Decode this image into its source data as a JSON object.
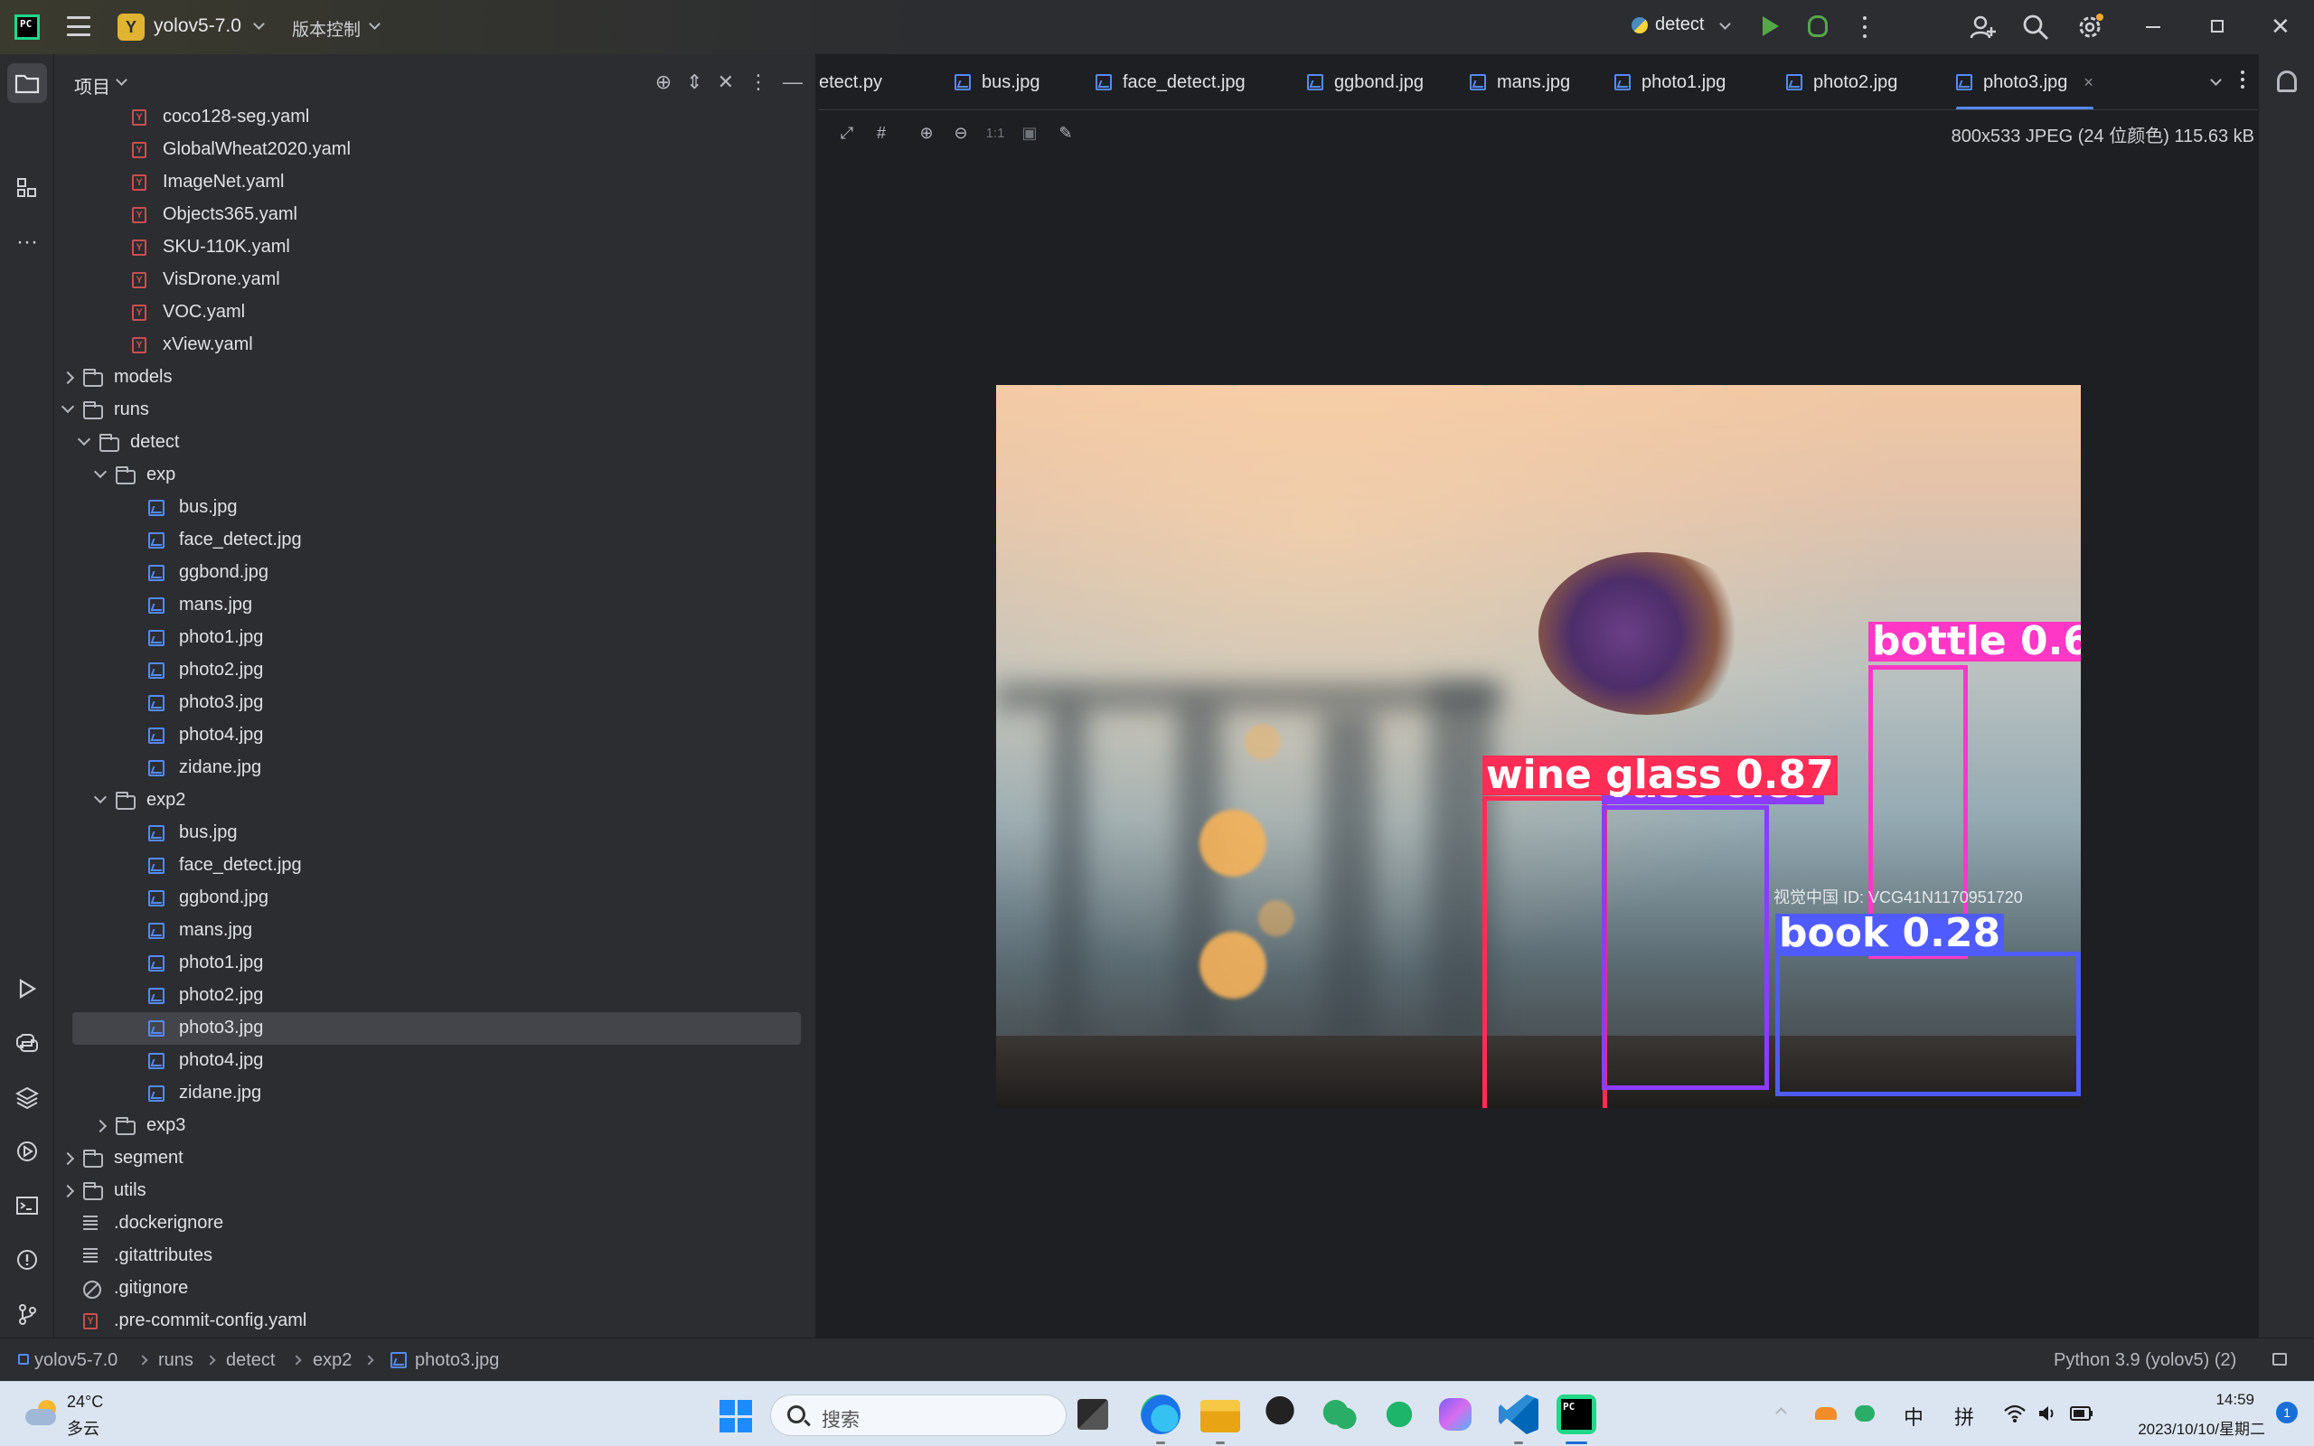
{
  "titlebar": {
    "project_badge": "Y",
    "project_name": "yolov5-7.0",
    "vcs_label": "版本控制",
    "run_config": "detect"
  },
  "project_panel": {
    "title": "项目",
    "tree": [
      {
        "label": "coco128-seg.yaml",
        "type": "yaml",
        "depth": 4
      },
      {
        "label": "GlobalWheat2020.yaml",
        "type": "yaml",
        "depth": 4
      },
      {
        "label": "ImageNet.yaml",
        "type": "yaml",
        "depth": 4
      },
      {
        "label": "Objects365.yaml",
        "type": "yaml",
        "depth": 4
      },
      {
        "label": "SKU-110K.yaml",
        "type": "yaml",
        "depth": 4
      },
      {
        "label": "VisDrone.yaml",
        "type": "yaml",
        "depth": 4
      },
      {
        "label": "VOC.yaml",
        "type": "yaml",
        "depth": 4
      },
      {
        "label": "xView.yaml",
        "type": "yaml",
        "depth": 4
      },
      {
        "label": "models",
        "type": "folder",
        "depth": 1,
        "arrow": "right"
      },
      {
        "label": "runs",
        "type": "folder",
        "depth": 1,
        "arrow": "down"
      },
      {
        "label": "detect",
        "type": "folder",
        "depth": 2,
        "arrow": "down"
      },
      {
        "label": "exp",
        "type": "folder",
        "depth": 3,
        "arrow": "down"
      },
      {
        "label": "bus.jpg",
        "type": "image",
        "depth": 5
      },
      {
        "label": "face_detect.jpg",
        "type": "image",
        "depth": 5
      },
      {
        "label": "ggbond.jpg",
        "type": "image",
        "depth": 5
      },
      {
        "label": "mans.jpg",
        "type": "image",
        "depth": 5
      },
      {
        "label": "photo1.jpg",
        "type": "image",
        "depth": 5
      },
      {
        "label": "photo2.jpg",
        "type": "image",
        "depth": 5
      },
      {
        "label": "photo3.jpg",
        "type": "image",
        "depth": 5
      },
      {
        "label": "photo4.jpg",
        "type": "image",
        "depth": 5
      },
      {
        "label": "zidane.jpg",
        "type": "image",
        "depth": 5
      },
      {
        "label": "exp2",
        "type": "folder",
        "depth": 3,
        "arrow": "down"
      },
      {
        "label": "bus.jpg",
        "type": "image",
        "depth": 5
      },
      {
        "label": "face_detect.jpg",
        "type": "image",
        "depth": 5
      },
      {
        "label": "ggbond.jpg",
        "type": "image",
        "depth": 5
      },
      {
        "label": "mans.jpg",
        "type": "image",
        "depth": 5
      },
      {
        "label": "photo1.jpg",
        "type": "image",
        "depth": 5
      },
      {
        "label": "photo2.jpg",
        "type": "image",
        "depth": 5
      },
      {
        "label": "photo3.jpg",
        "type": "image",
        "depth": 5,
        "selected": true
      },
      {
        "label": "photo4.jpg",
        "type": "image",
        "depth": 5
      },
      {
        "label": "zidane.jpg",
        "type": "image",
        "depth": 5
      },
      {
        "label": "exp3",
        "type": "folder",
        "depth": 3,
        "arrow": "right"
      },
      {
        "label": "segment",
        "type": "folder",
        "depth": 1,
        "arrow": "right"
      },
      {
        "label": "utils",
        "type": "folder",
        "depth": 1,
        "arrow": "right"
      },
      {
        "label": ".dockerignore",
        "type": "text",
        "depth": 1
      },
      {
        "label": ".gitattributes",
        "type": "text",
        "depth": 1
      },
      {
        "label": ".gitignore",
        "type": "ignore",
        "depth": 1
      },
      {
        "label": ".pre-commit-config.yaml",
        "type": "yaml",
        "depth": 1
      }
    ]
  },
  "editor": {
    "tabs": [
      {
        "label": "etect.py",
        "icon": "none"
      },
      {
        "label": "bus.jpg",
        "icon": "image"
      },
      {
        "label": "face_detect.jpg",
        "icon": "image"
      },
      {
        "label": "ggbond.jpg",
        "icon": "image"
      },
      {
        "label": "mans.jpg",
        "icon": "image"
      },
      {
        "label": "photo1.jpg",
        "icon": "image"
      },
      {
        "label": "photo2.jpg",
        "icon": "image"
      },
      {
        "label": "photo3.jpg",
        "icon": "image",
        "active": true
      }
    ],
    "tab_close": "×",
    "image_toolbar": {
      "actual_size_label": "1:1"
    },
    "image_info": "800x533 JPEG (24 位颜色) 115.63 kB",
    "detections": [
      {
        "label": "wine glass 0.87",
        "color": "#ff2d55"
      },
      {
        "label": "vase 0.85",
        "color": "#8b3dff"
      },
      {
        "label": "bottle 0.6",
        "color": "#ff37c7"
      },
      {
        "label": "book 0.28",
        "color": "#4f5bff"
      }
    ],
    "watermark": "视觉中国  ID: VCG41N1170951720"
  },
  "statusbar": {
    "breadcrumbs": [
      "yolov5-7.0",
      "runs",
      "detect",
      "exp2",
      "photo3.jpg"
    ],
    "interpreter": "Python 3.9 (yolov5) (2)"
  },
  "taskbar": {
    "temperature": "24°C",
    "condition": "多云",
    "search_placeholder": "搜索",
    "tray_ime_1": "中",
    "tray_ime_2": "拼",
    "time": "14:59",
    "date": "2023/10/10/星期二",
    "notification_count": "1"
  },
  "colors": {
    "accent": "#548af7",
    "run_green": "#57a64a",
    "selection": "#43454a",
    "panel_bg": "#2b2d30",
    "editor_bg": "#1e1f22"
  }
}
